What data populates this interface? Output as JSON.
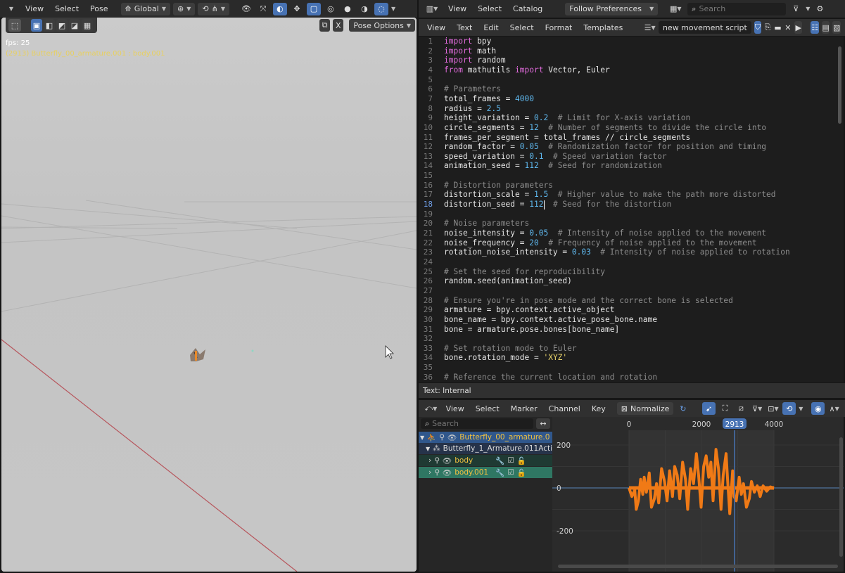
{
  "viewport": {
    "menu": [
      "View",
      "Select",
      "Pose"
    ],
    "transform_orientation": "Global",
    "pose_options": "Pose Options",
    "x_label": "X",
    "fps": "fps: 25",
    "active_label": "(2913) Butterfly_00_armature.001 : body.001"
  },
  "editor": {
    "top_menu": [
      "View",
      "Select",
      "Catalog"
    ],
    "follow_prefs": "Follow Preferences",
    "search_placeholder": "Search",
    "menu": [
      "View",
      "Text",
      "Edit",
      "Select",
      "Format",
      "Templates"
    ],
    "script_name": "new movement script",
    "status": "Text: Internal",
    "current_line": 18,
    "lines": [
      {
        "n": "1",
        "segs": [
          [
            "kw",
            "import"
          ],
          [
            "ph",
            " bpy"
          ]
        ]
      },
      {
        "n": "2",
        "segs": [
          [
            "kw",
            "import"
          ],
          [
            "ph",
            " math"
          ]
        ]
      },
      {
        "n": "3",
        "segs": [
          [
            "kw",
            "import"
          ],
          [
            "ph",
            " random"
          ]
        ]
      },
      {
        "n": "4",
        "segs": [
          [
            "kw",
            "from"
          ],
          [
            "ph",
            " mathutils "
          ],
          [
            "kw",
            "import"
          ],
          [
            "ph",
            " Vector, Euler"
          ]
        ]
      },
      {
        "n": "5",
        "segs": []
      },
      {
        "n": "6",
        "segs": [
          [
            "cm",
            "# Parameters"
          ]
        ]
      },
      {
        "n": "7",
        "segs": [
          [
            "ph",
            "total_frames "
          ],
          [
            "op",
            "="
          ],
          [
            "num",
            " 4000"
          ]
        ]
      },
      {
        "n": "8",
        "segs": [
          [
            "ph",
            "radius "
          ],
          [
            "op",
            "="
          ],
          [
            "num",
            " 2.5"
          ]
        ]
      },
      {
        "n": "9",
        "segs": [
          [
            "ph",
            "height_variation "
          ],
          [
            "op",
            "="
          ],
          [
            "num",
            " 0.2"
          ],
          [
            "cm",
            "  # Limit for X-axis variation"
          ]
        ]
      },
      {
        "n": "10",
        "segs": [
          [
            "ph",
            "circle_segments "
          ],
          [
            "op",
            "="
          ],
          [
            "num",
            " 12"
          ],
          [
            "cm",
            "  # Number of segments to divide the circle into"
          ]
        ]
      },
      {
        "n": "11",
        "segs": [
          [
            "ph",
            "frames_per_segment "
          ],
          [
            "op",
            "="
          ],
          [
            "ph",
            " total_frames "
          ],
          [
            "op",
            "//"
          ],
          [
            "ph",
            " circle_segments"
          ]
        ]
      },
      {
        "n": "12",
        "segs": [
          [
            "ph",
            "random_factor "
          ],
          [
            "op",
            "="
          ],
          [
            "num",
            " 0.05"
          ],
          [
            "cm",
            "  # Randomization factor for position and timing"
          ]
        ]
      },
      {
        "n": "13",
        "segs": [
          [
            "ph",
            "speed_variation "
          ],
          [
            "op",
            "="
          ],
          [
            "num",
            " 0.1"
          ],
          [
            "cm",
            "  # Speed variation factor"
          ]
        ]
      },
      {
        "n": "14",
        "segs": [
          [
            "ph",
            "animation_seed "
          ],
          [
            "op",
            "="
          ],
          [
            "num",
            " 112"
          ],
          [
            "cm",
            "  # Seed for randomization"
          ]
        ]
      },
      {
        "n": "15",
        "segs": []
      },
      {
        "n": "16",
        "segs": [
          [
            "cm",
            "# Distortion parameters"
          ]
        ]
      },
      {
        "n": "17",
        "segs": [
          [
            "ph",
            "distortion_scale "
          ],
          [
            "op",
            "="
          ],
          [
            "num",
            " 1.5"
          ],
          [
            "cm",
            "  # Higher value to make the path more distorted"
          ]
        ]
      },
      {
        "n": "18",
        "segs": [
          [
            "ph",
            "distortion_seed "
          ],
          [
            "op",
            "="
          ],
          [
            "num",
            " 112"
          ],
          [
            "cm",
            "  # Seed for the distortion"
          ]
        ]
      },
      {
        "n": "19",
        "segs": []
      },
      {
        "n": "20",
        "segs": [
          [
            "cm",
            "# Noise parameters"
          ]
        ]
      },
      {
        "n": "21",
        "segs": [
          [
            "ph",
            "noise_intensity "
          ],
          [
            "op",
            "="
          ],
          [
            "num",
            " 0.05"
          ],
          [
            "cm",
            "  # Intensity of noise applied to the movement"
          ]
        ]
      },
      {
        "n": "22",
        "segs": [
          [
            "ph",
            "noise_frequency "
          ],
          [
            "op",
            "="
          ],
          [
            "num",
            " 20"
          ],
          [
            "cm",
            "  # Frequency of noise applied to the movement"
          ]
        ]
      },
      {
        "n": "23",
        "segs": [
          [
            "ph",
            "rotation_noise_intensity "
          ],
          [
            "op",
            "="
          ],
          [
            "num",
            " 0.03"
          ],
          [
            "cm",
            "  # Intensity of noise applied to rotation"
          ]
        ]
      },
      {
        "n": "24",
        "segs": []
      },
      {
        "n": "25",
        "segs": [
          [
            "cm",
            "# Set the seed for reproducibility"
          ]
        ]
      },
      {
        "n": "26",
        "segs": [
          [
            "ph",
            "random.seed(animation_seed)"
          ]
        ]
      },
      {
        "n": "27",
        "segs": []
      },
      {
        "n": "28",
        "segs": [
          [
            "cm",
            "# Ensure you're in pose mode and the correct bone is selected"
          ]
        ]
      },
      {
        "n": "29",
        "segs": [
          [
            "ph",
            "armature "
          ],
          [
            "op",
            "="
          ],
          [
            "ph",
            " bpy.context.active_object"
          ]
        ]
      },
      {
        "n": "30",
        "segs": [
          [
            "ph",
            "bone_name "
          ],
          [
            "op",
            "="
          ],
          [
            "ph",
            " bpy.context.active_pose_bone.name"
          ]
        ]
      },
      {
        "n": "31",
        "segs": [
          [
            "ph",
            "bone "
          ],
          [
            "op",
            "="
          ],
          [
            "ph",
            " armature.pose.bones[bone_name]"
          ]
        ]
      },
      {
        "n": "32",
        "segs": []
      },
      {
        "n": "33",
        "segs": [
          [
            "cm",
            "# Set rotation mode to Euler"
          ]
        ]
      },
      {
        "n": "34",
        "segs": [
          [
            "ph",
            "bone.rotation_mode "
          ],
          [
            "op",
            "="
          ],
          [
            "str",
            " 'XYZ'"
          ]
        ]
      },
      {
        "n": "35",
        "segs": []
      },
      {
        "n": "36",
        "segs": [
          [
            "cm",
            "# Reference the current location and rotation"
          ]
        ]
      }
    ]
  },
  "graph": {
    "menu": [
      "View",
      "Select",
      "Marker",
      "Channel",
      "Key"
    ],
    "normalize": "Normalize",
    "search_placeholder": "Search",
    "frame_ticks": [
      "0",
      "2000",
      "4000"
    ],
    "current_frame": "2913",
    "value_ticks": [
      "200",
      "0",
      "-200"
    ],
    "channels": [
      {
        "label": "Butterfly_00_armature.0",
        "kind": "object"
      },
      {
        "label": "Butterfly_1_Armature.011Acti",
        "kind": "action"
      },
      {
        "label": "body",
        "kind": "group"
      },
      {
        "label": "body.001",
        "kind": "group-selected"
      }
    ],
    "curve_color": "#f07a16",
    "accent": "#4772b3"
  }
}
